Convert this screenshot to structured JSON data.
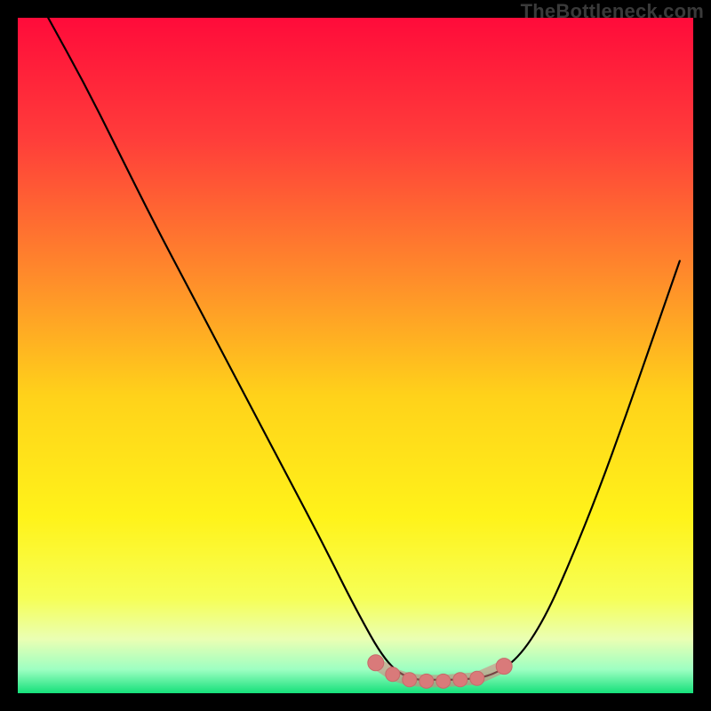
{
  "attribution": "TheBottleneck.com",
  "colors": {
    "gradient_stops": [
      {
        "offset": 0.0,
        "color": "#ff0b3a"
      },
      {
        "offset": 0.18,
        "color": "#ff3d3a"
      },
      {
        "offset": 0.38,
        "color": "#ff8a2b"
      },
      {
        "offset": 0.56,
        "color": "#ffd21a"
      },
      {
        "offset": 0.74,
        "color": "#fff31a"
      },
      {
        "offset": 0.86,
        "color": "#f6ff57"
      },
      {
        "offset": 0.92,
        "color": "#eaffb3"
      },
      {
        "offset": 0.965,
        "color": "#9dffc2"
      },
      {
        "offset": 1.0,
        "color": "#15e07a"
      }
    ],
    "marker_fill": "#d97a7a",
    "marker_stroke": "#c76a6a",
    "curve_stroke": "#000000"
  },
  "chart_data": {
    "type": "line",
    "title": "",
    "xlabel": "",
    "ylabel": "",
    "xlim": [
      0,
      1
    ],
    "ylim": [
      0,
      1
    ],
    "series": [
      {
        "name": "curve",
        "x": [
          0.045,
          0.1,
          0.15,
          0.2,
          0.25,
          0.3,
          0.35,
          0.4,
          0.45,
          0.5,
          0.545,
          0.58,
          0.62,
          0.66,
          0.7,
          0.74,
          0.78,
          0.82,
          0.86,
          0.9,
          0.94,
          0.98
        ],
        "y": [
          1.0,
          0.9,
          0.8,
          0.7,
          0.605,
          0.51,
          0.415,
          0.32,
          0.225,
          0.125,
          0.045,
          0.02,
          0.02,
          0.02,
          0.025,
          0.05,
          0.11,
          0.2,
          0.3,
          0.41,
          0.525,
          0.64
        ]
      }
    ],
    "markers": {
      "name": "highlight-points",
      "x": [
        0.53,
        0.555,
        0.58,
        0.605,
        0.63,
        0.655,
        0.68,
        0.72
      ],
      "y": [
        0.045,
        0.028,
        0.02,
        0.018,
        0.018,
        0.02,
        0.022,
        0.04
      ]
    }
  }
}
